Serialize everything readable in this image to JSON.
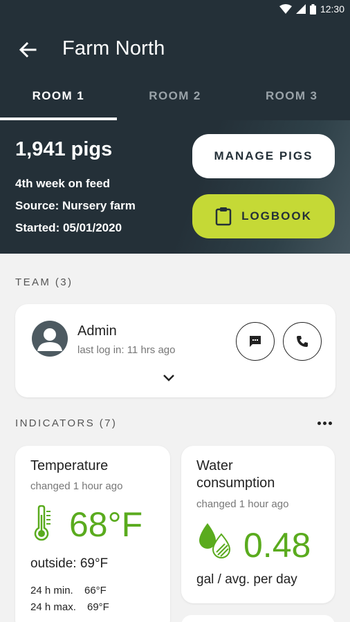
{
  "status_bar": {
    "time": "12:30",
    "icons": [
      "wifi-icon",
      "signal-icon",
      "battery-icon"
    ]
  },
  "app_bar": {
    "title": "Farm North",
    "back_icon": "arrow-left-icon"
  },
  "tabs": [
    {
      "label": "ROOM 1",
      "active": true
    },
    {
      "label": "ROOM 2",
      "active": false
    },
    {
      "label": "ROOM 3",
      "active": false
    }
  ],
  "room": {
    "pig_count": "1,941 pigs",
    "feed_week": "4th week on feed",
    "source": "Source: Nursery farm",
    "started": "Started: 05/01/2020",
    "manage_label": "MANAGE PIGS",
    "logbook_label": "LOGBOOK"
  },
  "team": {
    "label": "TEAM (3)",
    "member": {
      "name": "Admin",
      "last_log": "last log in: 11 hrs ago"
    }
  },
  "indicators": {
    "label": "INDICATORS (7)",
    "temperature": {
      "title": "Temperature",
      "changed": "changed 1 hour ago",
      "value": "68°F",
      "outside": "outside: 69°F",
      "min_label": "24 h min.",
      "min_value": "66°F",
      "max_label": "24 h max.",
      "max_value": "69°F"
    },
    "water": {
      "title_line1": "Water",
      "title_line2": "consumption",
      "changed": "changed 1 hour ago",
      "value": "0.48",
      "unit": "gal / avg. per day"
    }
  },
  "colors": {
    "header": "#243038",
    "accent_green": "#5aab1e",
    "logbook_button": "#c5d936",
    "background": "#f2f2f2"
  }
}
